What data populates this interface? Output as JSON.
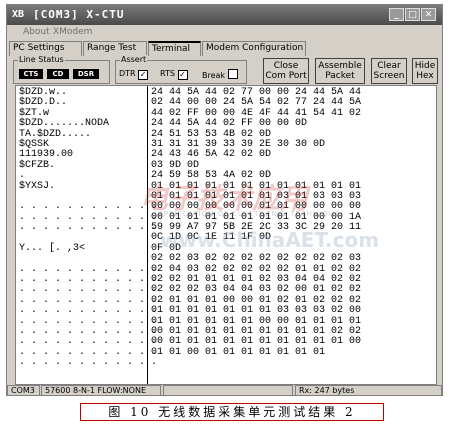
{
  "window": {
    "title": "[COM3] X-CTU",
    "app_icon": "XB"
  },
  "menu": {
    "items": [
      "About",
      "XModem"
    ]
  },
  "tabs": [
    "PC Settings",
    "Range Test",
    "Terminal",
    "Modem Configuration"
  ],
  "line_status": {
    "title": "Line Status",
    "indicators": [
      "CTS",
      "CD",
      "DSR"
    ]
  },
  "assert": {
    "title": "Assert",
    "checks": [
      {
        "label": "DTR",
        "checked": true
      },
      {
        "label": "RTS",
        "checked": true
      },
      {
        "label": "Break",
        "checked": false
      }
    ]
  },
  "buttons": {
    "close_port": [
      "Close",
      "Com Port"
    ],
    "assemble": [
      "Assemble",
      "Packet"
    ],
    "clear": [
      "Clear",
      "Screen"
    ],
    "hide": [
      "Hide",
      "Hex"
    ]
  },
  "terminal": {
    "ascii_lines": [
      "$DZD.w..",
      "$DZD.D..",
      "$ZT.w",
      "$DZD.......NODA",
      "TA.$DZD.....",
      "$QSSK",
      "111939.00",
      "$CFZB.",
      ".",
      "$YXSJ.",
      "",
      ". . . . . . . . . . . .",
      ". . . . . . . . . . . .",
      ". . . . . . . . . . . .",
      "",
      "Y... [. ,3<",
      "",
      ". . . . . . . . . . . .",
      ". . . . . . . . . . . .",
      ". . . . . . . . . . . .",
      ". . . . . . . . . . . .",
      ". . . . . . . . . . . .",
      ". . . . . . . . . . . .",
      ". . . . . . . . . . . .",
      ". . . . . . . . . . . .",
      ". . . . . . . . . . . .",
      ". . . . . . . . . . . ."
    ],
    "hex_lines": [
      "24 44 5A 44 02 77 00 00 24 44 5A 44",
      "02 44 00 00 24 5A 54 02 77 24 44 5A",
      "44 02 FF 00 00 4E 4F 44 41 54 41 02",
      "24 44 5A 44 02 FF 00 00 0D",
      "24 51 53 53 4B 02 0D",
      "31 31 31 39 33 39 2E 30 30 0D",
      "24 43 46 5A 42 02 0D",
      "03 9D 0D",
      "24 59 58 53 4A 02 0D",
      "01 01 01 01 01 01 01 01 01 01 01 01",
      "01 01 01 01 01 01 01 03 01 03 03 03",
      "00 00 00 00 00 00 01 01 00 00 00 00",
      "00 01 01 01 01 01 01 01 01 00 00 1A",
      "59 99 A7 97 5B 2E 2C 33 3C 29 20 11",
      "0C 1D 0C 1E 11 1F 0D",
      "0F 0D",
      "02 02 03 02 02 02 02 02 02 02 02 03",
      "02 04 03 02 02 02 02 02 01 01 02 02",
      "02 02 01 01 01 01 02 03 04 04 02 02",
      "02 02 02 03 04 04 03 02 00 01 02 02",
      "02 01 01 01 00 00 01 02 01 02 02 02",
      "01 01 01 01 01 01 01 03 03 03 02 00",
      "01 01 01 01 01 01 00 00 01 01 01 01",
      "00 01 01 01 01 01 01 01 01 01 02 02",
      "00 01 01 01 01 01 01 01 01 01 01 00",
      "01 01 00 01 01 01 01 01 01 01"
    ]
  },
  "status": {
    "port": "COM3",
    "settings": "57600 8-N-1  FLOW:NONE",
    "rx": "Rx: 247 bytes"
  },
  "watermark": {
    "main": "电子技术应用",
    "sub": "APPLICATION OF ELECTRONIC TECHNIQUE",
    "url": "www.ChinaAET.com"
  },
  "caption": "图 10  无线数据采集单元测试结果 2"
}
